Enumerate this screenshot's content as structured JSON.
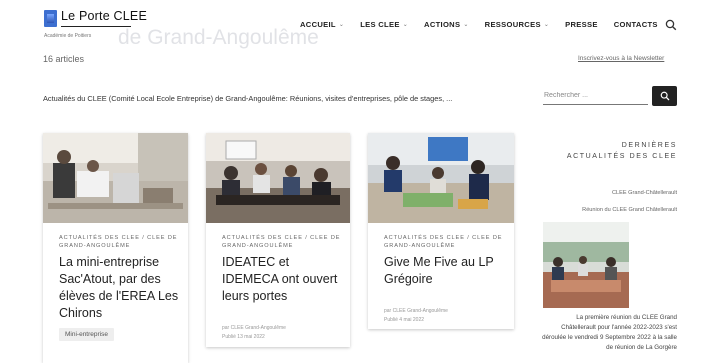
{
  "site": {
    "logo_title": "Le Porte CLEE",
    "logo_subtitle": "Académie de Poitiers",
    "background_title": "de Grand-Angoulême"
  },
  "nav": {
    "items": [
      {
        "label": "ACCUEIL",
        "dropdown": true
      },
      {
        "label": "LES CLEE",
        "dropdown": true
      },
      {
        "label": "ACTIONS",
        "dropdown": true
      },
      {
        "label": "RESSOURCES",
        "dropdown": true
      },
      {
        "label": "PRESSE",
        "dropdown": false
      },
      {
        "label": "CONTACTS",
        "dropdown": false
      }
    ],
    "chevron": "⌄",
    "search_icon": "search-icon"
  },
  "archive": {
    "count_text": "16 articles",
    "newsletter_link": "Inscrivez-vous à la Newsletter",
    "intro": "Actualités du CLEE (Comité Local Ecole Entreprise) de Grand-Angoulême: Réunions, visites d'entreprises, pôle de stages, ..."
  },
  "search": {
    "placeholder": "Rechercher ..."
  },
  "cards": [
    {
      "category": "Actualités des CLEE / CLEE de Grand-Angoulême",
      "title": "La mini-entreprise Sac'Atout, par des élèves de l'EREA Les Chirons",
      "tag": "Mini-entreprise"
    },
    {
      "category": "Actualités des CLEE / CLEE de Grand-Angoulême",
      "title": "IDEATEC et IDEMECA ont ouvert leurs portes",
      "author": "par CLEE Grand-Angoulême",
      "date": "Publié 13 mai 2022"
    },
    {
      "category": "Actualités des CLEE / CLEE de Grand-Angoulême",
      "title": "Give Me Five au LP Grégoire",
      "author": "par CLEE Grand-Angoulême",
      "date": "Publié 4 mai 2022"
    }
  ],
  "sidebar": {
    "title": "DERNIÈRES ACTUALITÉS DES CLEE",
    "line1": "CLEE Grand-Châtellerault",
    "line2": "Réunion du CLEE Grand Châtellerault",
    "desc": "La première réunion du CLEE Grand Châtellerault pour l'année 2022-2023 s'est déroulée le vendredi 9 Septembre 2022 à la salle de réunion de La Gorgère"
  },
  "colors": {
    "accent": "#222222",
    "logo_blue": "#3d6fd0"
  }
}
